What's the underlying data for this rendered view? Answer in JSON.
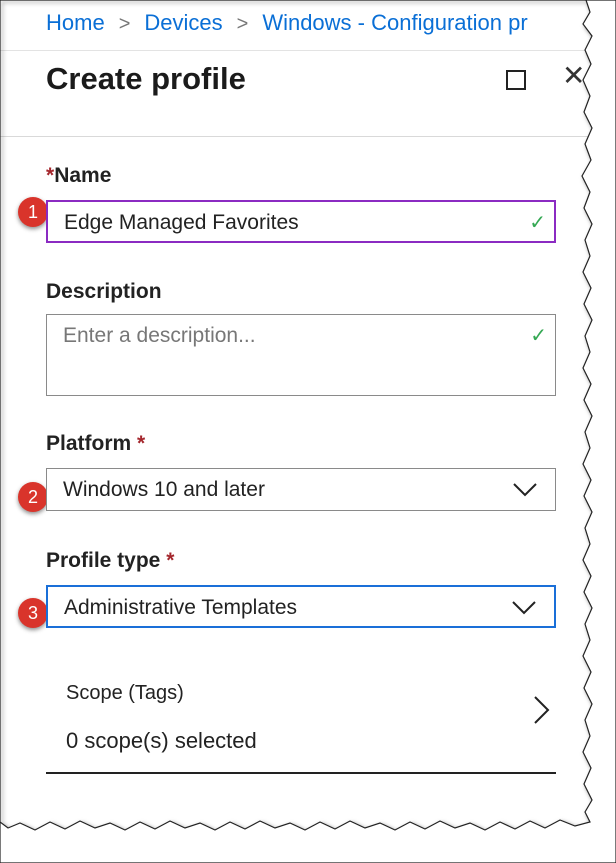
{
  "breadcrumb": {
    "items": [
      "Home",
      "Devices",
      "Windows - Configuration pr"
    ],
    "separator": ">"
  },
  "panel": {
    "title": "Create profile",
    "maximize_icon": "square-maximize-icon",
    "close_icon": "x-close-icon",
    "close_glyph": "✕"
  },
  "name": {
    "label": "Name",
    "required_mark": "*",
    "value": "Edge Managed Favorites",
    "badge": "1",
    "valid_glyph": "✓"
  },
  "description": {
    "label": "Description",
    "placeholder": "Enter a description...",
    "valid_glyph": "✓"
  },
  "platform": {
    "label": "Platform",
    "required_mark": "*",
    "value": "Windows 10 and later",
    "badge": "2"
  },
  "profile_type": {
    "label": "Profile type",
    "required_mark": "*",
    "value": "Administrative Templates",
    "badge": "3"
  },
  "scope": {
    "title": "Scope (Tags)",
    "value": "0 scope(s) selected"
  },
  "colors": {
    "link": "#0a6fd6",
    "required": "#a4262c",
    "badge": "#d9342b",
    "focus_purple": "#8b2bc2",
    "focus_blue": "#1a6fd8",
    "check": "#34a853"
  }
}
